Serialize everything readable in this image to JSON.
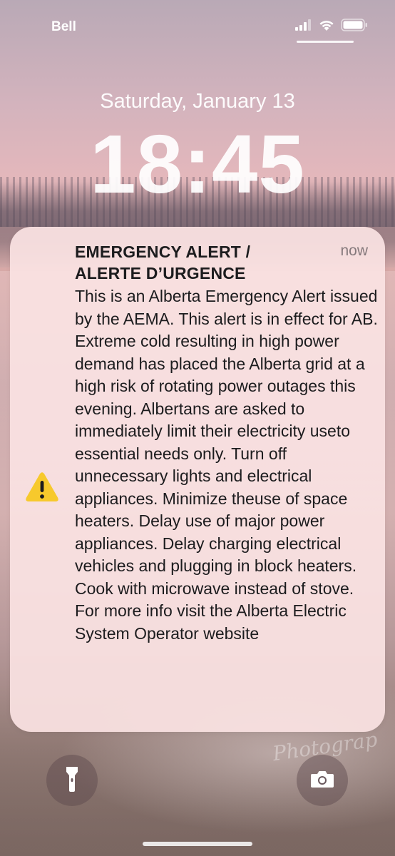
{
  "status_bar": {
    "carrier": "Bell",
    "icons": [
      "cellular-signal-icon",
      "wifi-icon",
      "battery-icon"
    ]
  },
  "lock_screen": {
    "date": "Saturday, January 13",
    "time": "18:45"
  },
  "notification": {
    "title": "EMERGENCY ALERT / ALERTE D’URGENCE",
    "time": "now",
    "icon": "warning-icon",
    "body": "This is an Alberta Emergency Alert issued by the AEMA.  This alert is in effect for AB.  Extreme cold resulting in high power demand has placed the Alberta grid at a high risk of rotating power outages this evening. Albertans are asked to immediately limit their electricity useto essential needs only. Turn off unnecessary lights and electrical appliances. Minimize theuse of space heaters. Delay use of major power appliances. Delay charging electrical vehicles and plugging in block heaters. Cook with microwave instead of stove. For more info visit the Alberta Electric System Operator website"
  },
  "quick_actions": {
    "left": "flashlight-icon",
    "right": "camera-icon"
  },
  "wallpaper": {
    "watermark": "Photograp"
  },
  "colors": {
    "warning_yellow": "#f7c92c",
    "notification_bg": "#fae2e2"
  }
}
